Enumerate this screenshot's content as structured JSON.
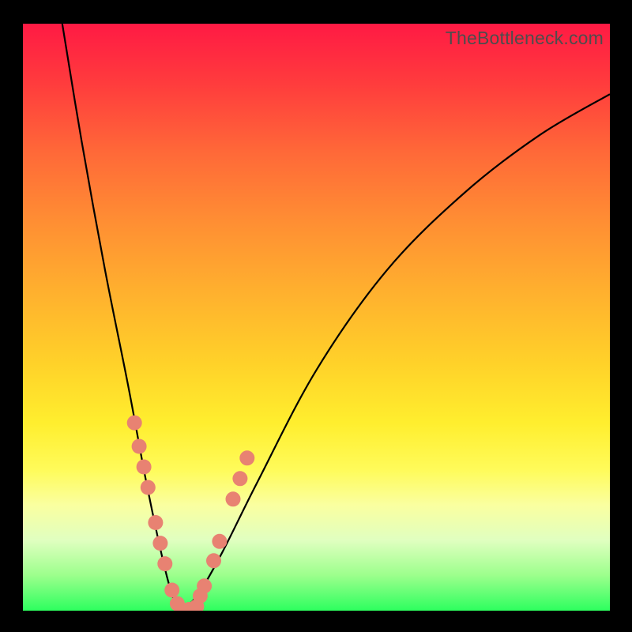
{
  "watermark": "TheBottleneck.com",
  "chart_data": {
    "type": "line",
    "title": "",
    "xlabel": "",
    "ylabel": "",
    "xlim": [
      0,
      100
    ],
    "ylim": [
      0,
      100
    ],
    "notes": "V-shaped bottleneck curve over a vertical red→yellow→green gradient background. Two smooth curves descend from top edges and meet near (27, 0). Salmon-colored circular markers are clustered along both curves near the bottom of the V. Axes are unlabeled; values approximate pixel positions as percentages.",
    "series": [
      {
        "name": "left-curve",
        "x": [
          6.7,
          10,
          14,
          18,
          21,
          24,
          26,
          27.2
        ],
        "y": [
          100,
          80,
          58,
          38,
          22,
          8,
          1,
          0
        ]
      },
      {
        "name": "right-curve",
        "x": [
          27.2,
          30,
          34,
          40,
          50,
          62,
          75,
          88,
          100
        ],
        "y": [
          0,
          3,
          10,
          22,
          41,
          58,
          71,
          81,
          88
        ]
      }
    ],
    "markers": {
      "left": [
        {
          "x": 19.0,
          "y": 32.0
        },
        {
          "x": 19.8,
          "y": 28.0
        },
        {
          "x": 20.6,
          "y": 24.5
        },
        {
          "x": 21.3,
          "y": 21.0
        },
        {
          "x": 22.6,
          "y": 15.0
        },
        {
          "x": 23.4,
          "y": 11.5
        },
        {
          "x": 24.2,
          "y": 8.0
        },
        {
          "x": 25.4,
          "y": 3.5
        },
        {
          "x": 26.3,
          "y": 1.2
        }
      ],
      "bottom": [
        {
          "x": 27.0,
          "y": 0.2
        },
        {
          "x": 28.3,
          "y": 0.2
        },
        {
          "x": 29.6,
          "y": 0.7
        }
      ],
      "right": [
        {
          "x": 30.2,
          "y": 2.5
        },
        {
          "x": 30.9,
          "y": 4.2
        },
        {
          "x": 32.5,
          "y": 8.5
        },
        {
          "x": 33.5,
          "y": 11.8
        },
        {
          "x": 35.8,
          "y": 19.0
        },
        {
          "x": 37.0,
          "y": 22.5
        },
        {
          "x": 38.2,
          "y": 26.0
        }
      ]
    }
  }
}
